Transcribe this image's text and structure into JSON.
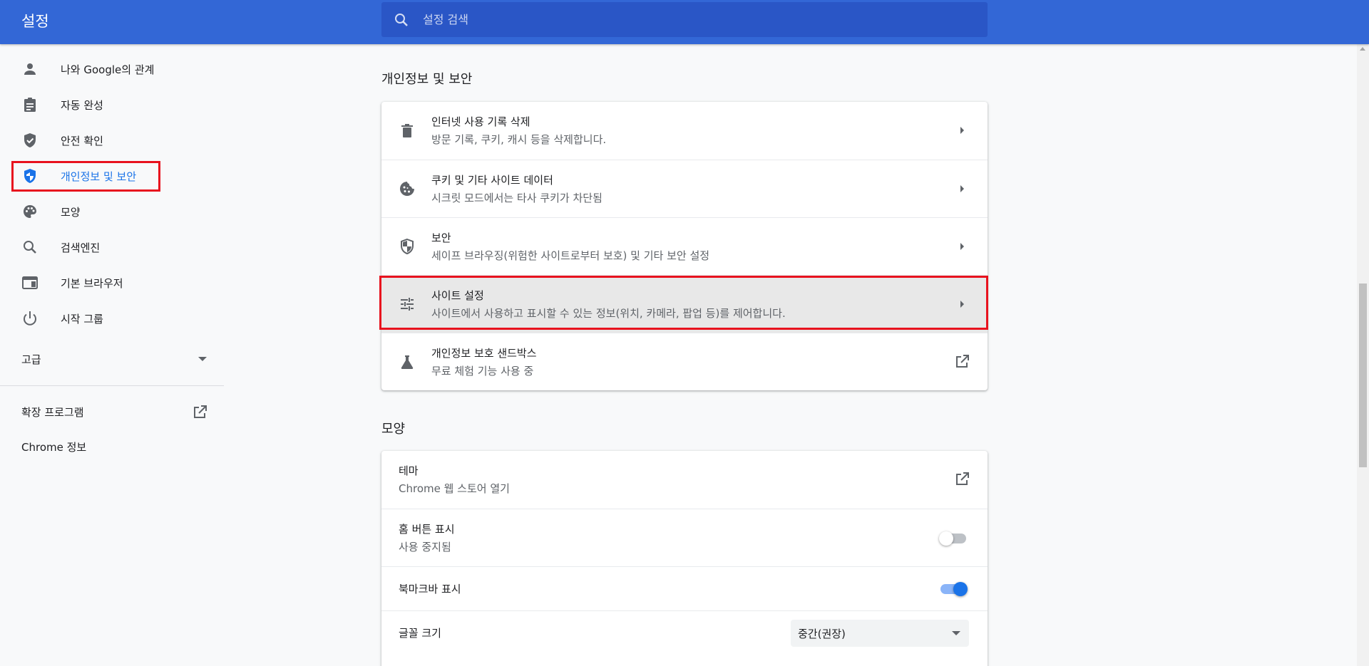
{
  "header": {
    "title": "설정",
    "search_placeholder": "설정 검색"
  },
  "sidebar": {
    "items": [
      {
        "label": "나와 Google의 관계",
        "icon": "person-icon"
      },
      {
        "label": "자동 완성",
        "icon": "clipboard-icon"
      },
      {
        "label": "안전 확인",
        "icon": "shield-check-icon"
      },
      {
        "label": "개인정보 및 보안",
        "icon": "shield-icon",
        "active": true
      },
      {
        "label": "모양",
        "icon": "palette-icon"
      },
      {
        "label": "검색엔진",
        "icon": "search-icon"
      },
      {
        "label": "기본 브라우저",
        "icon": "browser-icon"
      },
      {
        "label": "시작 그룹",
        "icon": "power-icon"
      }
    ],
    "advanced_label": "고급",
    "extensions_label": "확장 프로그램",
    "about_label": "Chrome 정보"
  },
  "privacy": {
    "title": "개인정보 및 보안",
    "rows": [
      {
        "title": "인터넷 사용 기록 삭제",
        "subtitle": "방문 기록, 쿠키, 캐시 등을 삭제합니다.",
        "icon": "trash-icon"
      },
      {
        "title": "쿠키 및 기타 사이트 데이터",
        "subtitle": "시크릿 모드에서는 타사 쿠키가 차단됨",
        "icon": "cookie-icon"
      },
      {
        "title": "보안",
        "subtitle": "세이프 브라우징(위험한 사이트로부터 보호) 및 기타 보안 설정",
        "icon": "shield-icon"
      },
      {
        "title": "사이트 설정",
        "subtitle": "사이트에서 사용하고 표시할 수 있는 정보(위치, 카메라, 팝업 등)를 제어합니다.",
        "icon": "tune-icon"
      },
      {
        "title": "개인정보 보호 샌드박스",
        "subtitle": "무료 체험 기능 사용 중",
        "icon": "flask-icon"
      }
    ]
  },
  "appearance": {
    "title": "모양",
    "theme_title": "테마",
    "theme_subtitle": "Chrome 웹 스토어 열기",
    "home_title": "홈 버튼 표시",
    "home_subtitle": "사용 중지됨",
    "home_enabled": false,
    "bookmark_title": "북마크바 표시",
    "bookmark_enabled": true,
    "font_title": "글꼴 크기",
    "font_value": "중간(권장)"
  },
  "colors": {
    "header": "#3367d6",
    "accent": "#1a73e8",
    "highlight": "#e8121e"
  }
}
